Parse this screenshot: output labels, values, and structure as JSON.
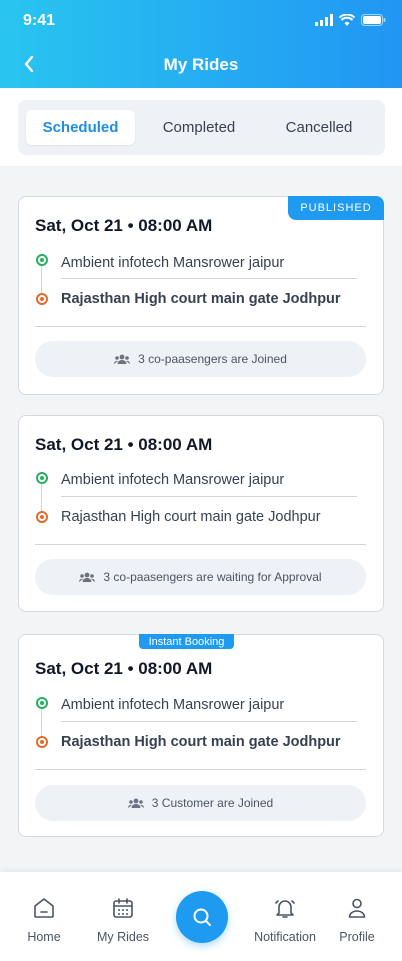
{
  "status_bar": {
    "time": "9:41"
  },
  "header": {
    "title": "My Rides"
  },
  "tabs": [
    {
      "label": "Scheduled",
      "active": true
    },
    {
      "label": "Completed",
      "active": false
    },
    {
      "label": "Cancelled",
      "active": false
    }
  ],
  "rides": [
    {
      "badge": "PUBLISHED",
      "datetime": "Sat, Oct 21 • 08:00 AM",
      "pickup": "Ambient infotech Mansrower jaipur",
      "drop": "Rajasthan High court main gate Jodhpur",
      "info": "3 co-paasengers are Joined"
    },
    {
      "badge": "",
      "datetime": "Sat, Oct 21 • 08:00 AM",
      "pickup": "Ambient infotech Mansrower jaipur",
      "drop": "Rajasthan High court main gate Jodhpur",
      "info": "3 co-paasengers are waiting for Approval"
    },
    {
      "badge": "Instant Booking",
      "datetime": "Sat, Oct 21 • 08:00 AM",
      "pickup": "Ambient infotech Mansrower jaipur",
      "drop": "Rajasthan High court main gate Jodhpur",
      "info": "3 Customer are Joined"
    }
  ],
  "bottom_nav": {
    "home": "Home",
    "my_rides": "My Rides",
    "notification": "Notification",
    "profile": "Profile"
  },
  "colors": {
    "accent": "#1e9bf0",
    "gradient_start": "#29c5f0",
    "pickup_dot": "#27ae60",
    "drop_dot": "#e26a2c"
  }
}
